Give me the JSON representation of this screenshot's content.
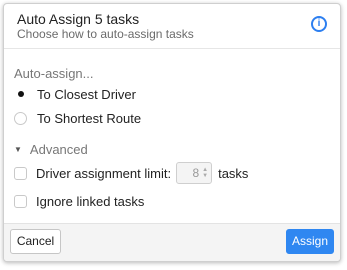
{
  "header": {
    "title": "Auto Assign 5 tasks",
    "subtitle": "Choose how to auto-assign tasks",
    "info_icon_glyph": "i",
    "info_icon_name": "info-icon"
  },
  "auto_assign": {
    "label": "Auto-assign...",
    "options": [
      {
        "label": "To Closest Driver",
        "selected": true
      },
      {
        "label": "To Shortest Route",
        "selected": false
      }
    ]
  },
  "advanced": {
    "caret_glyph": "▼",
    "label": "Advanced",
    "driver_limit": {
      "checked": false,
      "label": "Driver assignment limit:",
      "value": "8",
      "suffix": "tasks"
    },
    "ignore_linked": {
      "checked": false,
      "label": "Ignore linked tasks"
    }
  },
  "footer": {
    "cancel_label": "Cancel",
    "assign_label": "Assign"
  },
  "colors": {
    "accent": "#2f87f1",
    "info_icon": "#2d7ff0",
    "footer_bg": "#f4f4f4"
  }
}
